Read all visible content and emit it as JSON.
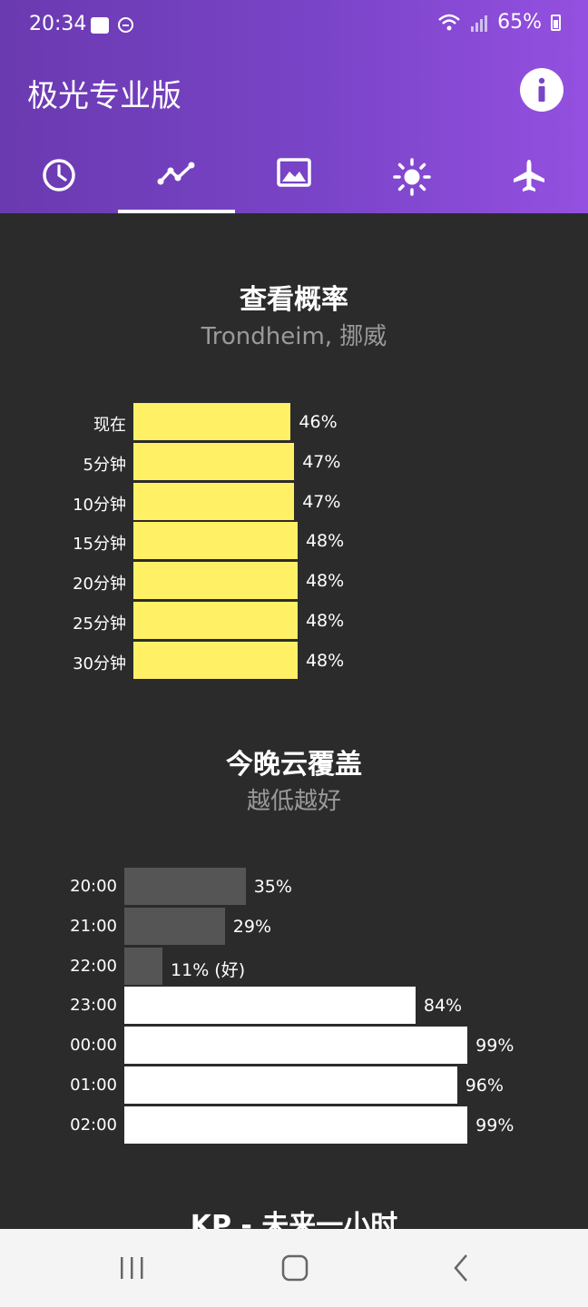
{
  "status": {
    "time": "20:34",
    "battery": "65%"
  },
  "app": {
    "title": "极光专业版"
  },
  "tabs": [
    {
      "icon": "clock-icon",
      "active": false
    },
    {
      "icon": "chart-line-icon",
      "active": true
    },
    {
      "icon": "image-icon",
      "active": false
    },
    {
      "icon": "sun-icon",
      "active": false
    },
    {
      "icon": "airplane-icon",
      "active": false
    }
  ],
  "probability": {
    "title": "查看概率",
    "subtitle": "Trondheim, 挪威",
    "rows": [
      {
        "label": "现在",
        "value_text": "46%",
        "value": 46
      },
      {
        "label": "5分钟",
        "value_text": "47%",
        "value": 47
      },
      {
        "label": "10分钟",
        "value_text": "47%",
        "value": 47
      },
      {
        "label": "15分钟",
        "value_text": "48%",
        "value": 48
      },
      {
        "label": "20分钟",
        "value_text": "48%",
        "value": 48
      },
      {
        "label": "25分钟",
        "value_text": "48%",
        "value": 48
      },
      {
        "label": "30分钟",
        "value_text": "48%",
        "value": 48
      }
    ],
    "bar_color": "#fff066"
  },
  "clouds": {
    "title": "今晚云覆盖",
    "subtitle": "越低越好",
    "rows": [
      {
        "label": "20:00",
        "value_text": "35%",
        "value": 35,
        "color": "#555555"
      },
      {
        "label": "21:00",
        "value_text": "29%",
        "value": 29,
        "color": "#555555"
      },
      {
        "label": "22:00",
        "value_text": "11% (好)",
        "value": 11,
        "color": "#555555"
      },
      {
        "label": "23:00",
        "value_text": "84%",
        "value": 84,
        "color": "#ffffff"
      },
      {
        "label": "00:00",
        "value_text": "99%",
        "value": 99,
        "color": "#ffffff"
      },
      {
        "label": "01:00",
        "value_text": "96%",
        "value": 96,
        "color": "#ffffff"
      },
      {
        "label": "02:00",
        "value_text": "99%",
        "value": 99,
        "color": "#ffffff"
      }
    ]
  },
  "kp": {
    "title": "KP - 未来一小时"
  }
}
